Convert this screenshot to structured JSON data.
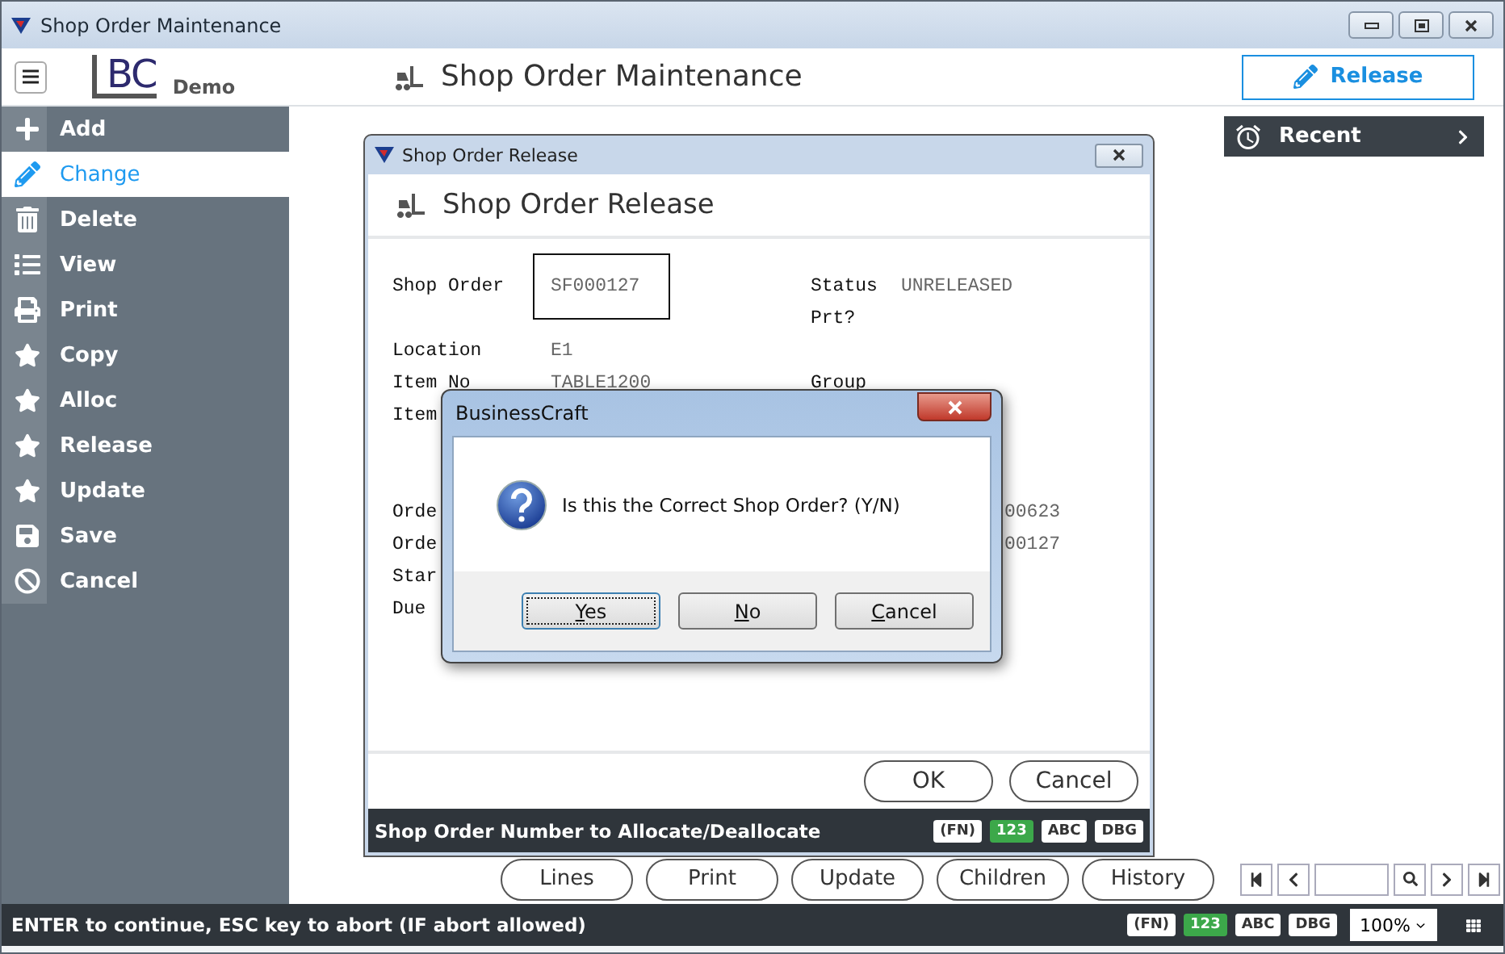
{
  "window": {
    "title": "Shop Order Maintenance"
  },
  "header": {
    "logo_text": "BC",
    "logo_caption": "Demo",
    "title": "Shop Order Maintenance",
    "action_button": "Release"
  },
  "sidebar": {
    "items": [
      {
        "label": "Add",
        "selected": false
      },
      {
        "label": "Change",
        "selected": true
      },
      {
        "label": "Delete",
        "selected": false
      },
      {
        "label": "View",
        "selected": false
      },
      {
        "label": "Print",
        "selected": false
      },
      {
        "label": "Copy",
        "selected": false
      },
      {
        "label": "Alloc",
        "selected": false
      },
      {
        "label": "Release",
        "selected": false
      },
      {
        "label": "Update",
        "selected": false
      },
      {
        "label": "Save",
        "selected": false
      },
      {
        "label": "Cancel",
        "selected": false
      }
    ]
  },
  "recent": {
    "label": "Recent"
  },
  "release_dialog": {
    "title": "Shop Order Release",
    "heading": "Shop Order Release",
    "rows": [
      {
        "label": "Shop Order",
        "input": "SF000127",
        "right_label": "Status",
        "right_value": "UNRELEASED"
      },
      {
        "right_label": "Prt?"
      },
      {
        "label": "Location",
        "value": "E1"
      },
      {
        "label": "Item No",
        "value": "TABLE1200",
        "right_label": "Group"
      },
      {
        "label": "Item"
      },
      {},
      {},
      {
        "label": "Orde",
        "tail_value": "00623"
      },
      {
        "label": "Orde",
        "tail_value": "00127"
      },
      {
        "label": "Star"
      },
      {
        "label": "Due"
      }
    ],
    "buttons": [
      "OK",
      "Cancel"
    ],
    "status_bar": {
      "message": "Shop Order Number to Allocate/Deallocate",
      "badges": [
        {
          "label": "(FN)",
          "on": false
        },
        {
          "label": "123",
          "on": true
        },
        {
          "label": "ABC",
          "on": false
        },
        {
          "label": "DBG",
          "on": false
        }
      ]
    }
  },
  "message_box": {
    "title": "BusinessCraft",
    "message": "Is this the Correct Shop Order? (Y/N)",
    "buttons": [
      {
        "label": "Yes",
        "default": true
      },
      {
        "label": "No",
        "default": false
      },
      {
        "label": "Cancel",
        "default": false
      }
    ]
  },
  "action_buttons": [
    "Lines",
    "Print",
    "Update",
    "Children",
    "History"
  ],
  "status_bar": {
    "message": "ENTER to continue, ESC key to abort (IF abort allowed)",
    "badges": [
      {
        "label": "(FN)",
        "on": false
      },
      {
        "label": "123",
        "on": true
      },
      {
        "label": "ABC",
        "on": false
      },
      {
        "label": "DBG",
        "on": false
      }
    ],
    "zoom": "100%"
  }
}
